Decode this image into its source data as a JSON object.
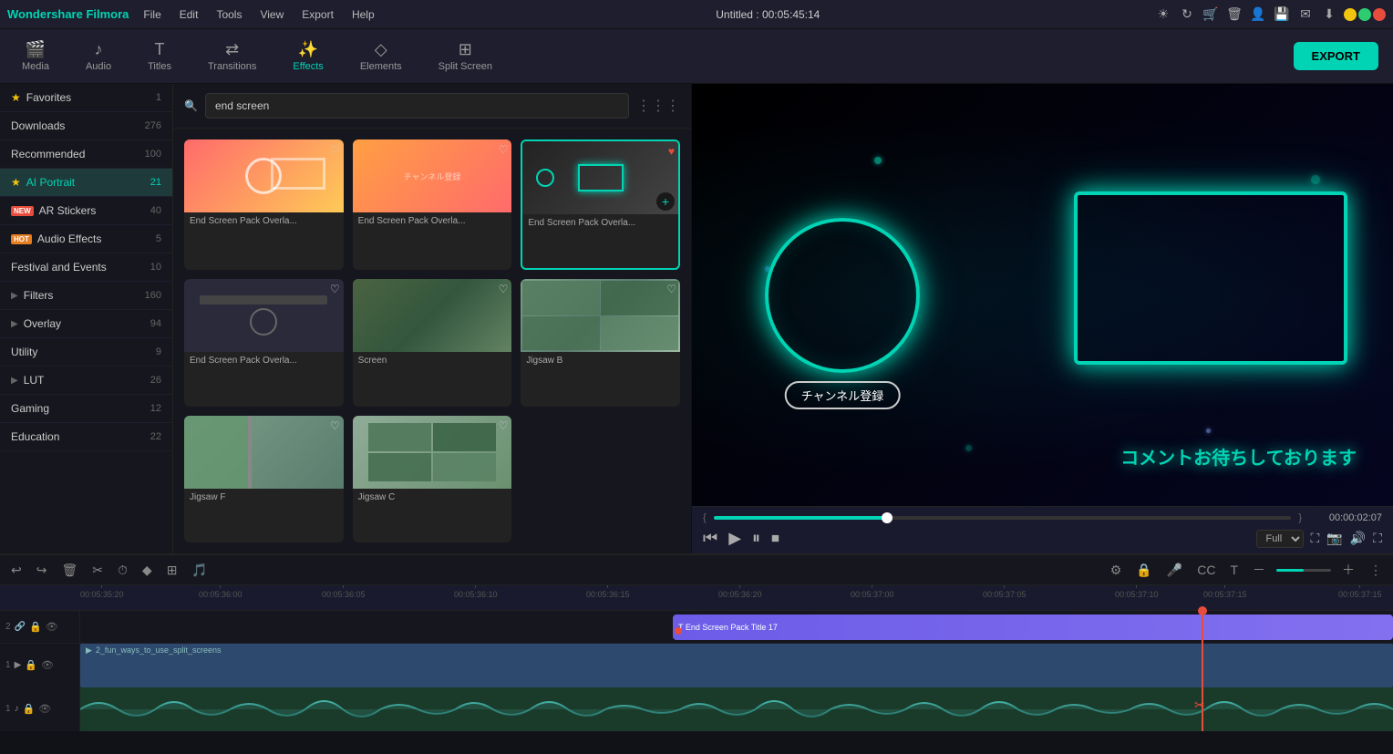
{
  "titlebar": {
    "logo": "Wondershare Filmora",
    "menus": [
      "File",
      "Edit",
      "Tools",
      "View",
      "Export",
      "Help"
    ],
    "title": "Untitled : 00:05:45:14",
    "win_controls": [
      "minimize",
      "maximize",
      "close"
    ]
  },
  "toolbar": {
    "tabs": [
      {
        "id": "media",
        "label": "Media",
        "icon": "🎬"
      },
      {
        "id": "audio",
        "label": "Audio",
        "icon": "🎵"
      },
      {
        "id": "titles",
        "label": "Titles",
        "icon": "T"
      },
      {
        "id": "transitions",
        "label": "Transitions",
        "icon": "⇄"
      },
      {
        "id": "effects",
        "label": "Effects",
        "icon": "✨"
      },
      {
        "id": "elements",
        "label": "Elements",
        "icon": "◇"
      },
      {
        "id": "split_screen",
        "label": "Split Screen",
        "icon": "⊞"
      }
    ],
    "active_tab": "effects",
    "export_label": "EXPORT"
  },
  "sidebar": {
    "items": [
      {
        "id": "favorites",
        "label": "Favorites",
        "count": "1",
        "has_star": true,
        "badge": ""
      },
      {
        "id": "downloads",
        "label": "Downloads",
        "count": "276",
        "has_star": false,
        "badge": ""
      },
      {
        "id": "recommended",
        "label": "Recommended",
        "count": "100",
        "has_star": false,
        "badge": ""
      },
      {
        "id": "ai_portrait",
        "label": "AI Portrait",
        "count": "21",
        "has_star": true,
        "badge": ""
      },
      {
        "id": "ar_stickers",
        "label": "AR Stickers",
        "count": "40",
        "has_star": false,
        "badge": "NEW"
      },
      {
        "id": "audio_effects",
        "label": "Audio Effects",
        "count": "5",
        "has_star": false,
        "badge": "HOT"
      },
      {
        "id": "festival_events",
        "label": "Festival and Events",
        "count": "10",
        "has_star": false,
        "badge": ""
      },
      {
        "id": "filters",
        "label": "Filters",
        "count": "160",
        "has_star": false,
        "badge": "",
        "has_expand": true
      },
      {
        "id": "overlay",
        "label": "Overlay",
        "count": "94",
        "has_star": false,
        "badge": "",
        "has_expand": true
      },
      {
        "id": "utility",
        "label": "Utility",
        "count": "9",
        "has_star": false,
        "badge": ""
      },
      {
        "id": "lut",
        "label": "LUT",
        "count": "26",
        "has_star": false,
        "badge": "",
        "has_expand": true
      },
      {
        "id": "gaming",
        "label": "Gaming",
        "count": "12",
        "has_star": false,
        "badge": ""
      },
      {
        "id": "education",
        "label": "Education",
        "count": "22",
        "has_star": false,
        "badge": ""
      }
    ]
  },
  "search": {
    "placeholder": "end screen",
    "value": "end screen"
  },
  "effects": {
    "items": [
      {
        "id": "e1",
        "label": "End Screen Pack Overla...",
        "thumb_class": "thumb-1",
        "selected": false
      },
      {
        "id": "e2",
        "label": "End Screen Pack Overla...",
        "thumb_class": "thumb-2",
        "selected": false
      },
      {
        "id": "e3",
        "label": "End Screen Pack Overla...",
        "thumb_class": "thumb-3",
        "selected": true
      },
      {
        "id": "e4",
        "label": "End Screen Pack Overla...",
        "thumb_class": "thumb-4",
        "selected": false
      },
      {
        "id": "e5",
        "label": "Screen",
        "thumb_class": "thumb-5",
        "selected": false
      },
      {
        "id": "e6",
        "label": "Jigsaw B",
        "thumb_class": "thumb-6",
        "selected": false
      },
      {
        "id": "e7",
        "label": "Jigsaw F",
        "thumb_class": "thumb-7",
        "selected": false
      },
      {
        "id": "e8",
        "label": "Jigsaw C",
        "thumb_class": "thumb-8",
        "selected": false
      }
    ]
  },
  "preview": {
    "time_current": "00:00:02:07",
    "quality": "Full",
    "subscribe_text": "チャンネル登録",
    "comment_text": "コメントお待ちしております",
    "progress_percent": 30
  },
  "timeline": {
    "current_time": "00:05:37:10",
    "ruler_marks": [
      "00:05:35:20",
      "00:05:36:00",
      "00:05:36:05",
      "00:05:36:10",
      "00:05:36:15",
      "00:05:36:20",
      "00:05:37:00",
      "00:05:37:05",
      "00:05:37:10",
      "00:05:37:15",
      "00:05:37:15"
    ],
    "tracks": [
      {
        "num": "2",
        "type": "effects",
        "label": "End Screen Pack Title 17"
      },
      {
        "num": "1",
        "type": "video",
        "label": "2_fun_ways_to_use_split_screens"
      },
      {
        "num": "1",
        "type": "audio",
        "label": ""
      }
    ]
  },
  "toolbar_timeline": {
    "buttons": [
      "undo",
      "redo",
      "delete",
      "cut",
      "duration",
      "keyframe",
      "multi",
      "audio"
    ]
  }
}
